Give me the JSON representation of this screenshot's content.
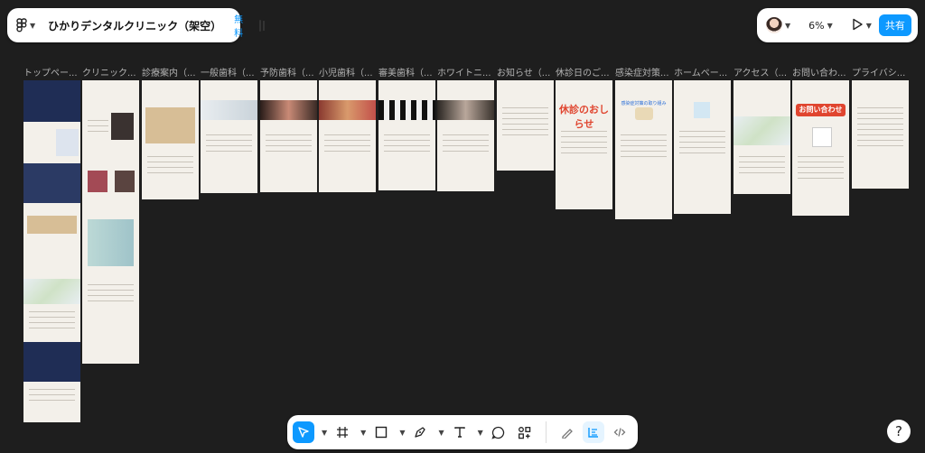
{
  "file": {
    "name": "ひかりデンタルクリニック（架空）",
    "plan_badge": "無料"
  },
  "toolbar_right": {
    "zoom": "6%",
    "share_label": "共有"
  },
  "frames": [
    {
      "label": "トップペー..."
    },
    {
      "label": "クリニック..."
    },
    {
      "label": "診療案内（..."
    },
    {
      "label": "一般歯科（..."
    },
    {
      "label": "予防歯科（..."
    },
    {
      "label": "小児歯科（..."
    },
    {
      "label": "審美歯科（..."
    },
    {
      "label": "ホワイトニ..."
    },
    {
      "label": "お知らせ（..."
    },
    {
      "label": "休診日のご..."
    },
    {
      "label": "感染症対策..."
    },
    {
      "label": "ホームペー..."
    },
    {
      "label": "アクセス（..."
    },
    {
      "label": "お問い合わ..."
    },
    {
      "label": "プライバシ..."
    }
  ],
  "frame_images": {
    "closure_notice": "休診のおしらせ",
    "contact": "お問い合わせ",
    "infection_text": "感染症対策の取り組み"
  },
  "colors": {
    "accent": "#0d99ff",
    "canvas": "#1e1e1e",
    "frame_bg": "#f3f0ea",
    "navy": "#1f2d55",
    "gold": "#d7be96"
  },
  "icons": [
    "figma-logo-icon",
    "chevron-down-icon",
    "sidebar-toggle-icon",
    "avatar",
    "play-icon",
    "move-tool-icon",
    "frame-tool-icon",
    "rectangle-tool-icon",
    "pen-tool-icon",
    "text-tool-icon",
    "comment-tool-icon",
    "actions-icon",
    "draw-mode-icon",
    "design-mode-icon",
    "dev-mode-icon",
    "help-icon"
  ]
}
